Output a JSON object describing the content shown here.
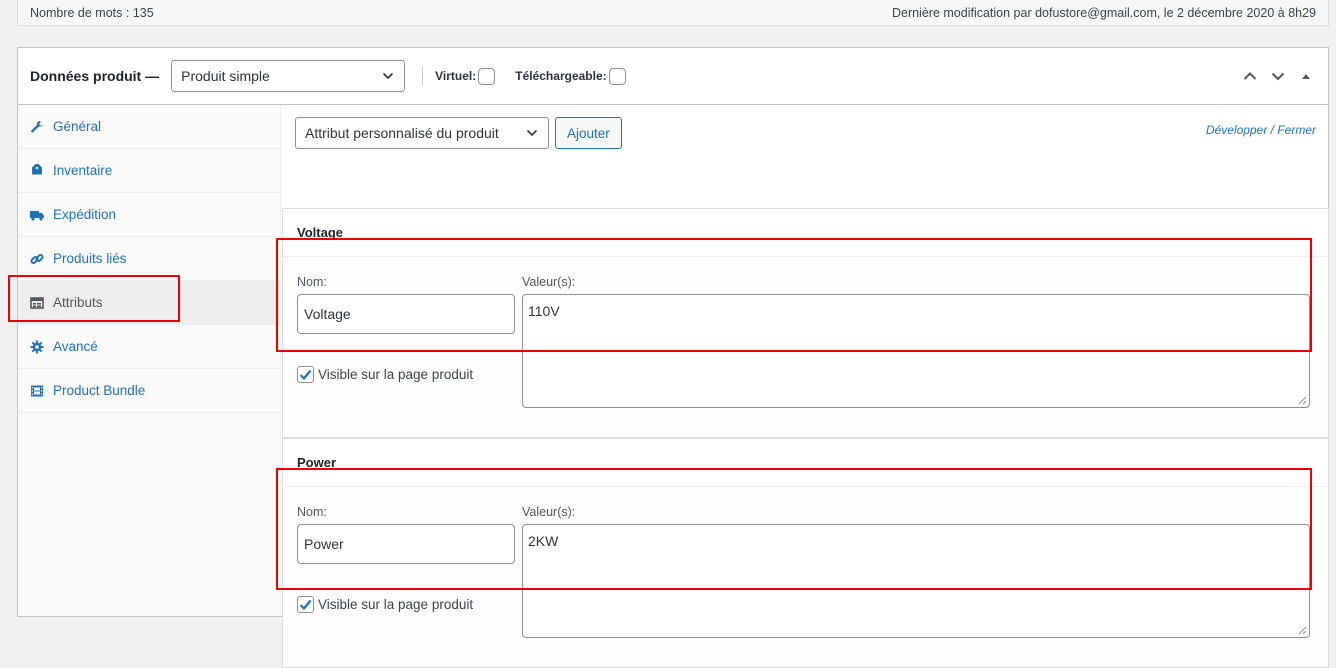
{
  "status": {
    "word_count": "Nombre de mots : 135",
    "last_modified": "Dernière modification par dofustore@gmail.com, le 2 décembre 2020 à 8h29"
  },
  "panel": {
    "title": "Données produit —",
    "product_type": "Produit simple",
    "virtual_label": "Virtuel:",
    "downloadable_label": "Téléchargeable:"
  },
  "tabs": [
    {
      "label": "Général",
      "icon": "wrench-icon"
    },
    {
      "label": "Inventaire",
      "icon": "tag-icon"
    },
    {
      "label": "Expédition",
      "icon": "truck-icon"
    },
    {
      "label": "Produits liés",
      "icon": "link-icon"
    },
    {
      "label": "Attributs",
      "icon": "table-icon",
      "active": true
    },
    {
      "label": "Avancé",
      "icon": "gear-icon"
    },
    {
      "label": "Product Bundle",
      "icon": "film-icon"
    }
  ],
  "toolbar": {
    "attribute_select": "Attribut personnalisé du produit",
    "add_button": "Ajouter",
    "expand": "Développer",
    "close": "Fermer"
  },
  "attributes": [
    {
      "title": "Voltage",
      "name_label": "Nom:",
      "values_label": "Valeur(s):",
      "name": "Voltage",
      "values": "110V",
      "visible_label": "Visible sur la page produit",
      "visible": true
    },
    {
      "title": "Power",
      "name_label": "Nom:",
      "values_label": "Valeur(s):",
      "name": "Power",
      "values": "2KW",
      "visible_label": "Visible sur la page produit",
      "visible": true
    }
  ],
  "colors": {
    "link": "#2271b1",
    "highlight": "#e00000"
  }
}
